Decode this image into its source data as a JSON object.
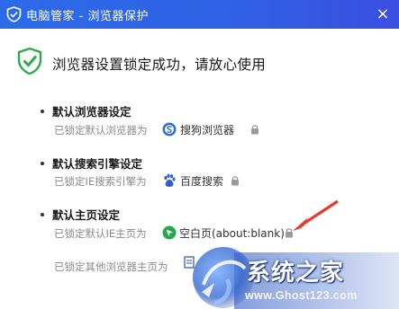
{
  "window": {
    "title": "电脑管家 - 浏览器保护",
    "close_glyph": "×"
  },
  "headline": "浏览器设置锁定成功，请放心使用",
  "sections": [
    {
      "title": "默认浏览器设定",
      "label": "已锁定默认浏览器为",
      "value": "搜狗浏览器"
    },
    {
      "title": "默认搜索引擎设定",
      "label": "已锁定IE搜索引擎为",
      "value": "百度搜索"
    },
    {
      "title": "默认主页设定",
      "label": "已锁定默认IE主页为",
      "value": "空白页(about:blank)"
    }
  ],
  "other_row": {
    "label": "已锁定其他浏览器主页为"
  },
  "watermark": {
    "logo_text": "系统之家",
    "url": "www.Ghost123.com"
  },
  "colors": {
    "titlebar": "#2f62e6",
    "accent_green": "#2eaa47",
    "arrow_red": "#e63a2e"
  },
  "icons": {
    "title": "shield-icon",
    "headline": "check-shield-icon",
    "browser": "sogou-icon",
    "search": "baidu-paw-icon",
    "homepage": "blank-page-icon",
    "lock": "lock-icon"
  }
}
